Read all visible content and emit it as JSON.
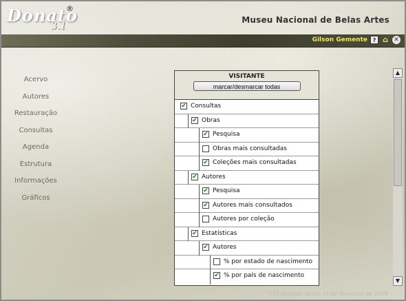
{
  "header": {
    "logo_text": "Donato",
    "logo_reg": "®",
    "logo_version": "3.1",
    "museum_title": "Museu Nacional de Belas Artes"
  },
  "topbar": {
    "user_name": "Gilson Gemente",
    "help_glyph": "?",
    "home_glyph": "⌂",
    "close_glyph": "✕"
  },
  "nav": {
    "items": [
      {
        "label": "Acervo"
      },
      {
        "label": "Autores"
      },
      {
        "label": "Restauração"
      },
      {
        "label": "Consultas"
      },
      {
        "label": "Agenda"
      },
      {
        "label": "Estrutura"
      },
      {
        "label": "Informações"
      },
      {
        "label": "Gráficos"
      }
    ]
  },
  "panel": {
    "title": "VISITANTE",
    "toggle_label": "marcar/desmarcar todas",
    "rows": [
      {
        "label": "Consultas",
        "level": 0,
        "checked": true
      },
      {
        "label": "Obras",
        "level": 1,
        "checked": true
      },
      {
        "label": "Pesquisa",
        "level": 2,
        "checked": true
      },
      {
        "label": "Obras mais consultadas",
        "level": 2,
        "checked": false
      },
      {
        "label": "Coleções mais consultadas",
        "level": 2,
        "checked": true
      },
      {
        "label": "Autores",
        "level": 1,
        "checked": true
      },
      {
        "label": "Pesquisa",
        "level": 2,
        "checked": true
      },
      {
        "label": "Autores mais consultados",
        "level": 2,
        "checked": true
      },
      {
        "label": "Autores por coleção",
        "level": 2,
        "checked": false
      },
      {
        "label": "Estatísticas",
        "level": 1,
        "checked": true
      },
      {
        "label": "Autores",
        "level": 2,
        "checked": true
      },
      {
        "label": "% por estado de nascimento",
        "level": 3,
        "checked": false
      },
      {
        "label": "% por país de nascimento",
        "level": 3,
        "checked": true
      }
    ]
  },
  "footer": {
    "text": "229 acessos desde 1º de fevereiro de 2008"
  },
  "colors": {
    "accent_text": "#f1e56a",
    "checkmark": "#1d7a1d"
  }
}
